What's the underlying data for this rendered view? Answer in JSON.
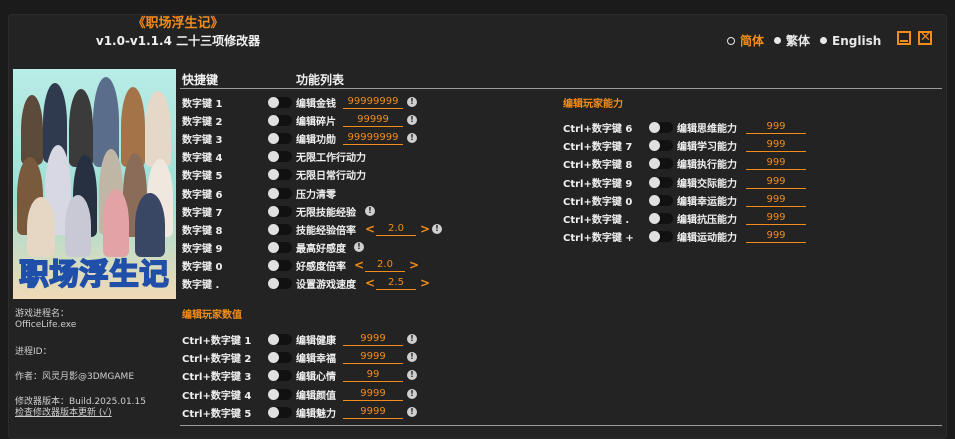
{
  "header": {
    "title": "《职场浮生记》",
    "subtitle": "v1.0-v1.1.4 二十三项修改器"
  },
  "languages": [
    {
      "label": "简体",
      "active": true
    },
    {
      "label": "繁体",
      "active": false
    },
    {
      "label": "English",
      "active": false
    }
  ],
  "cover": {
    "logo_text": "职场浮生记"
  },
  "info": {
    "process_label": "游戏进程名：",
    "process_name": "OfficeLife.exe",
    "pid_label": "进程ID：",
    "author": "作者：风灵月影@3DMGAME",
    "version": "修改器版本：Build.2025.01.15",
    "update_link": "检查修改器版本更新 (√)"
  },
  "columns": {
    "hotkey": "快捷键",
    "features": "功能列表"
  },
  "sections": {
    "player_stats": "编辑玩家数值",
    "player_abilities": "编辑玩家能力"
  },
  "main_rows": [
    {
      "key": "数字键 1",
      "label": "编辑金钱",
      "value": "99999999",
      "warn": true
    },
    {
      "key": "数字键 2",
      "label": "编辑碎片",
      "value": "99999",
      "warn": true
    },
    {
      "key": "数字键 3",
      "label": "编辑功勋",
      "value": "99999999",
      "warn": true
    },
    {
      "key": "数字键 4",
      "label": "无限工作行动力"
    },
    {
      "key": "数字键 5",
      "label": "无限日常行动力"
    },
    {
      "key": "数字键 6",
      "label": "压力清零"
    },
    {
      "key": "数字键 7",
      "label": "无限技能经验",
      "warn": true
    },
    {
      "key": "数字键 8",
      "label": "技能经验倍率",
      "value": "2.0",
      "arrows": true,
      "warn": true
    },
    {
      "key": "数字键 9",
      "label": "最高好感度",
      "warn": true
    },
    {
      "key": "数字键 0",
      "label": "好感度倍率",
      "value": "2.0",
      "arrows": true
    },
    {
      "key": "数字键 .",
      "label": "设置游戏速度",
      "value": "2.5",
      "arrows": true
    }
  ],
  "stat_rows": [
    {
      "key": "Ctrl+数字键 1",
      "label": "编辑健康",
      "value": "9999",
      "warn": true
    },
    {
      "key": "Ctrl+数字键 2",
      "label": "编辑幸福",
      "value": "9999",
      "warn": true
    },
    {
      "key": "Ctrl+数字键 3",
      "label": "编辑心情",
      "value": "99",
      "warn": true
    },
    {
      "key": "Ctrl+数字键 4",
      "label": "编辑颜值",
      "value": "9999",
      "warn": true
    },
    {
      "key": "Ctrl+数字键 5",
      "label": "编辑魅力",
      "value": "9999",
      "warn": true
    }
  ],
  "ability_rows": [
    {
      "key": "Ctrl+数字键 6",
      "label": "编辑思维能力",
      "value": "999"
    },
    {
      "key": "Ctrl+数字键 7",
      "label": "编辑学习能力",
      "value": "999"
    },
    {
      "key": "Ctrl+数字键 8",
      "label": "编辑执行能力",
      "value": "999"
    },
    {
      "key": "Ctrl+数字键 9",
      "label": "编辑交际能力",
      "value": "999"
    },
    {
      "key": "Ctrl+数字键 0",
      "label": "编辑幸运能力",
      "value": "999"
    },
    {
      "key": "Ctrl+数字键 .",
      "label": "编辑抗压能力",
      "value": "999"
    },
    {
      "key": "Ctrl+数字键 +",
      "label": "编辑运动能力",
      "value": "999"
    }
  ],
  "colors": {
    "accent": "#f28c1b",
    "background": "#232323",
    "text": "#f0f0f0"
  },
  "icons": {
    "warning": "exclamation-circle-icon",
    "minimize": "minimize-icon",
    "close": "close-icon"
  }
}
